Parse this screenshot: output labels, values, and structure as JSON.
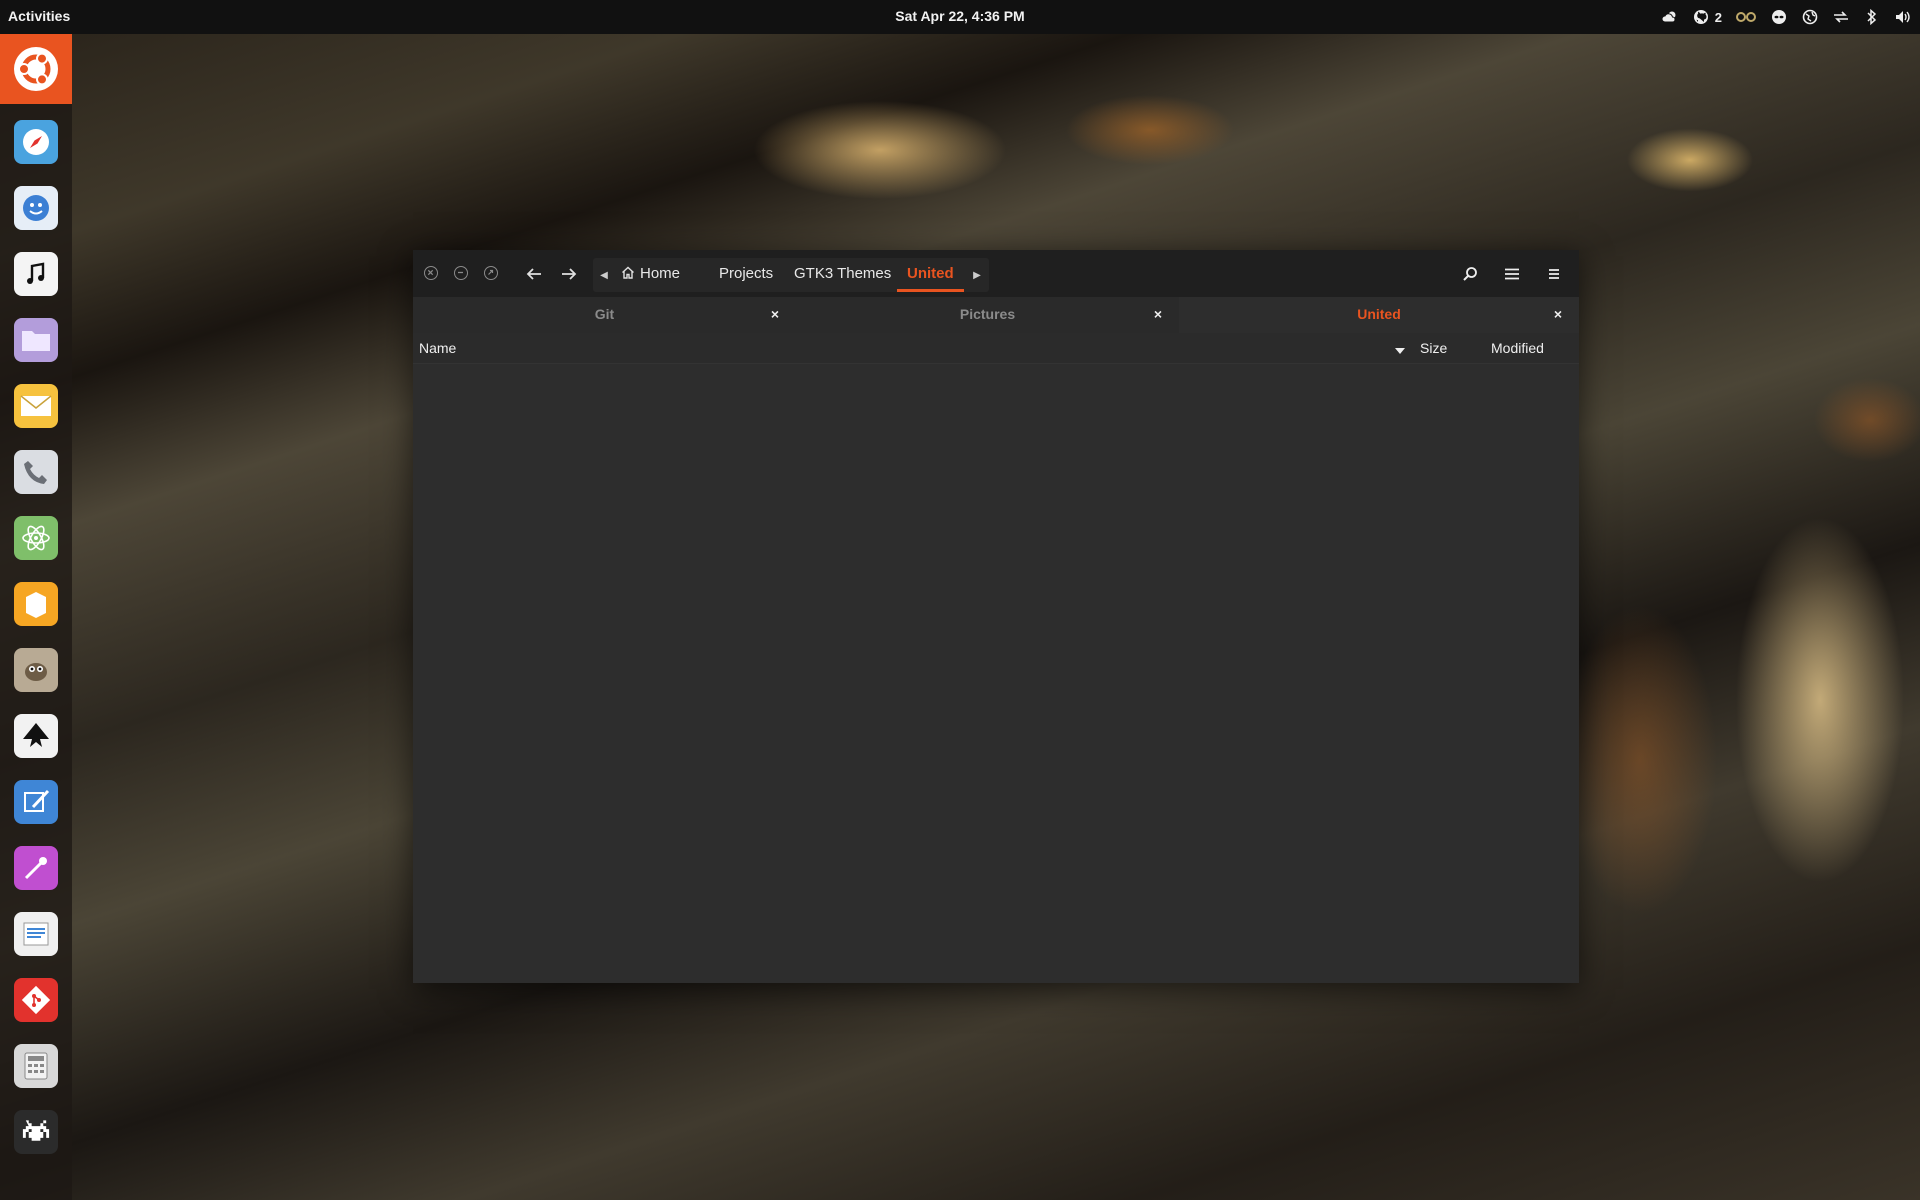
{
  "topbar": {
    "activities": "Activities",
    "clock": "Sat Apr 22,  4:36 PM",
    "tray": {
      "weather_icon": "weather-cloudy-icon",
      "github_icon": "github-icon",
      "github_count": "2",
      "indicator_icon": "infinity-indicator-icon",
      "user_icon": "alien-face-icon",
      "vpn_icon": "globe-vpn-icon",
      "sync_icon": "sync-arrows-icon",
      "bluetooth_icon": "bluetooth-icon",
      "volume_icon": "volume-icon"
    }
  },
  "dock": {
    "apps": [
      {
        "name": "safari-compass-icon",
        "color": "#4aa3df"
      },
      {
        "name": "finder-smile-icon",
        "color": "#e6eef7"
      },
      {
        "name": "music-note-icon",
        "color": "#f4f4f4"
      },
      {
        "name": "files-folder-icon",
        "color": "#b39ddb"
      },
      {
        "name": "mail-envelope-icon",
        "color": "#f6c23e"
      },
      {
        "name": "phone-icon",
        "color": "#dadde2"
      },
      {
        "name": "atom-editor-icon",
        "color": "#7fbf6a"
      },
      {
        "name": "archive-box-icon",
        "color": "#f6a623"
      },
      {
        "name": "gimp-icon",
        "color": "#b8aa94"
      },
      {
        "name": "inkscape-icon",
        "color": "#f2f2f2"
      },
      {
        "name": "paint-brush-icon",
        "color": "#3f86d6"
      },
      {
        "name": "color-picker-icon",
        "color": "#c04fd0"
      },
      {
        "name": "text-editor-icon",
        "color": "#f0f0f0"
      },
      {
        "name": "git-icon",
        "color": "#e2322d"
      },
      {
        "name": "calculator-icon",
        "color": "#d8d8d8"
      },
      {
        "name": "space-invader-icon",
        "color": "#2b2b2b"
      }
    ]
  },
  "window": {
    "path": {
      "home": "Home",
      "projects": "Projects",
      "gtk3_themes": "GTK3 Themes",
      "united": "United"
    },
    "tabs": [
      {
        "label": "Git"
      },
      {
        "label": "Pictures"
      },
      {
        "label": "United",
        "active": true
      }
    ],
    "tab_close": "×",
    "columns": {
      "name": "Name",
      "size": "Size",
      "modified": "Modified"
    }
  },
  "colors": {
    "accent": "#e95420",
    "headerbar": "#1f1f1f",
    "window_bg": "#2d2d2d"
  }
}
